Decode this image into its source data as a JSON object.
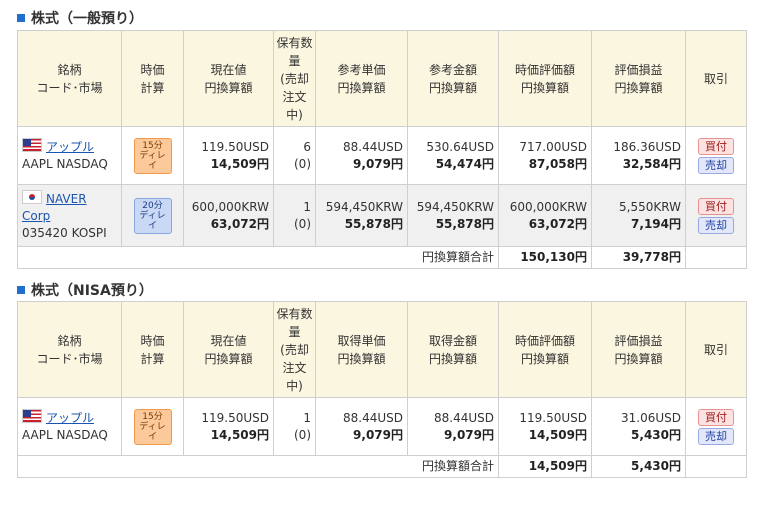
{
  "sections": [
    {
      "title": "株式（一般預り）",
      "headers": [
        "銘柄\nコード･市場",
        "時価\n計算",
        "現在値\n円換算額",
        "保有数量\n(売却注文中)",
        "参考単価\n円換算額",
        "参考金額\n円換算額",
        "時価評価額\n円換算額",
        "評価損益\n円換算額",
        "取引"
      ],
      "rows": [
        {
          "flag": "us-flag-icon",
          "name": "アップル",
          "code": "AAPL NASDAQ",
          "delay": "15分\nディレイ",
          "price": "119.50USD",
          "price_yen": "14,509円",
          "qty": "6",
          "qty_sell": "(0)",
          "unit": "88.44USD",
          "unit_yen": "9,079円",
          "amount": "530.64USD",
          "amount_yen": "54,474円",
          "value": "717.00USD",
          "value_yen": "87,058円",
          "pl": "186.36USD",
          "pl_yen": "32,584円",
          "buy": "買付",
          "sell": "売却"
        },
        {
          "flag": "kr-flag-icon",
          "name": "NAVER Corp",
          "code": "035420 KOSPI",
          "delay": "20分\nディレイ",
          "price": "600,000KRW",
          "price_yen": "63,072円",
          "qty": "1",
          "qty_sell": "(0)",
          "unit": "594,450KRW",
          "unit_yen": "55,878円",
          "amount": "594,450KRW",
          "amount_yen": "55,878円",
          "value": "600,000KRW",
          "value_yen": "63,072円",
          "pl": "5,550KRW",
          "pl_yen": "7,194円",
          "buy": "買付",
          "sell": "売却"
        }
      ],
      "total_label": "円換算額合計",
      "total_value": "150,130円",
      "total_pl": "39,778円"
    },
    {
      "title": "株式（NISA預り）",
      "headers": [
        "銘柄\nコード･市場",
        "時価\n計算",
        "現在値\n円換算額",
        "保有数量\n(売却注文中)",
        "取得単価\n円換算額",
        "取得金額\n円換算額",
        "時価評価額\n円換算額",
        "評価損益\n円換算額",
        "取引"
      ],
      "rows": [
        {
          "flag": "us-flag-icon",
          "name": "アップル",
          "code": "AAPL NASDAQ",
          "delay": "15分\nディレイ",
          "price": "119.50USD",
          "price_yen": "14,509円",
          "qty": "1",
          "qty_sell": "(0)",
          "unit": "88.44USD",
          "unit_yen": "9,079円",
          "amount": "88.44USD",
          "amount_yen": "9,079円",
          "value": "119.50USD",
          "value_yen": "14,509円",
          "pl": "31.06USD",
          "pl_yen": "5,430円",
          "buy": "買付",
          "sell": "売却"
        }
      ],
      "total_label": "円換算額合計",
      "total_value": "14,509円",
      "total_pl": "5,430円"
    }
  ]
}
